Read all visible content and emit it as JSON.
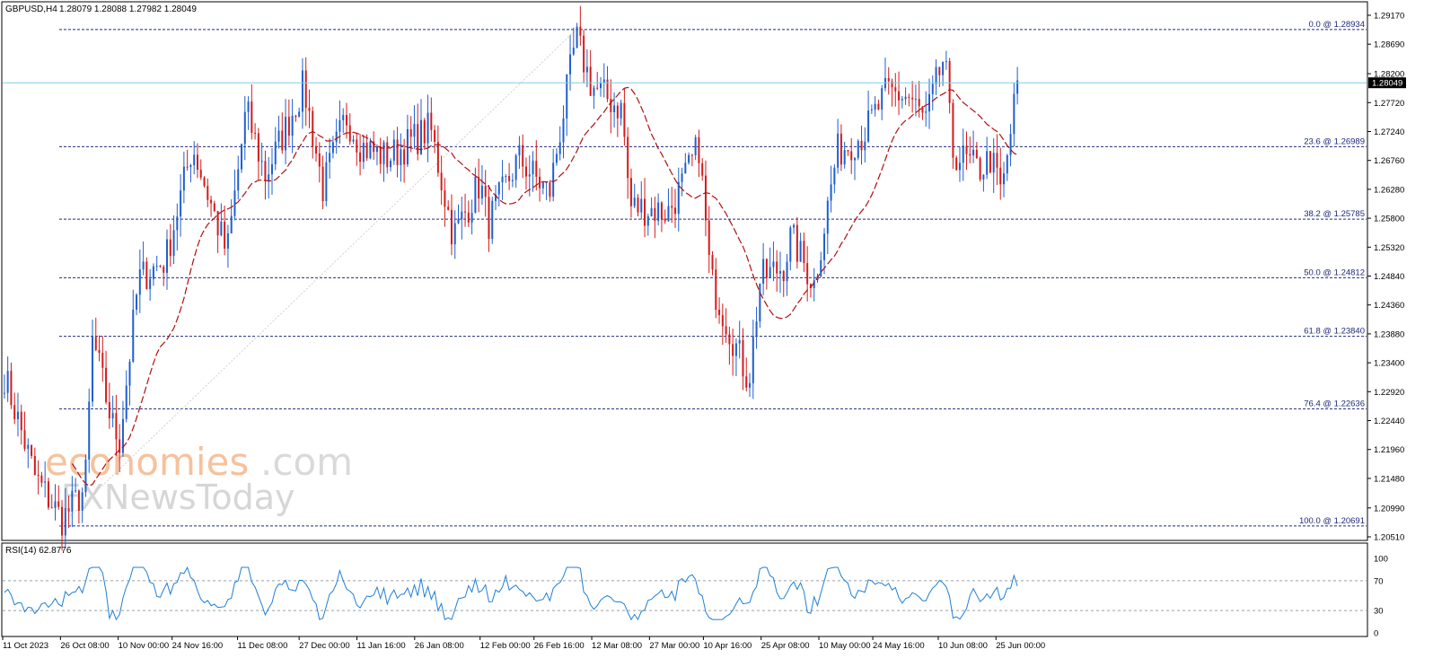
{
  "header": {
    "symbol": "GBPUSD,H4",
    "ohlc": "1.28079 1.28088 1.27982 1.28049"
  },
  "watermark": {
    "brand_a": "economies",
    "brand_b": ".com",
    "brand_c": "FXNewsToday"
  },
  "colors": {
    "candle": "#d41b1b",
    "candle_up": "#1f5fcf",
    "ma": "#b01010",
    "fib": "#1e2a7a",
    "current": "#7fcde6",
    "rsi": "#1e7fd6",
    "rsi_guides": "#9aa0a6"
  },
  "price_axis": {
    "ticks": [
      "1.29170",
      "1.28690",
      "1.28200",
      "1.27720",
      "1.27240",
      "1.26760",
      "1.26280",
      "1.25800",
      "1.25320",
      "1.24840",
      "1.24360",
      "1.23880",
      "1.23400",
      "1.22920",
      "1.22440",
      "1.21960",
      "1.21480",
      "1.20990",
      "1.20510"
    ],
    "current_price": "1.28049"
  },
  "time_axis": {
    "ticks": [
      "11 Oct 2023",
      "26 Oct 08:00",
      "10 Nov 00:00",
      "24 Nov 16:00",
      "11 Dec 08:00",
      "27 Dec 00:00",
      "11 Jan 16:00",
      "26 Jan 08:00",
      "12 Feb 00:00",
      "26 Feb 16:00",
      "12 Mar 08:00",
      "27 Mar 00:00",
      "10 Apr 16:00",
      "25 Apr 08:00",
      "10 May 00:00",
      "24 May 16:00",
      "10 Jun 08:00",
      "25 Jun 00:00"
    ]
  },
  "fib_levels": [
    {
      "label": "0.0 @ 1.28934"
    },
    {
      "label": "23.6 @ 1.26989"
    },
    {
      "label": "38.2 @ 1.25785"
    },
    {
      "label": "50.0 @ 1.24812"
    },
    {
      "label": "61.8 @ 1.23840"
    },
    {
      "label": "76.4 @ 1.22636"
    },
    {
      "label": "100.0 @ 1.20691"
    }
  ],
  "rsi": {
    "label": "RSI(14) 62.8776",
    "ticks": [
      "100",
      "70",
      "30",
      "0"
    ]
  },
  "chart_data": [
    {
      "type": "candlestick",
      "title": "GBPUSD,H4",
      "ylim": [
        1.2051,
        1.2917
      ],
      "x_start": "11 Oct 2023",
      "x_end": "1 Jul 2024",
      "waypoints": [
        {
          "x": "11 Oct 2023",
          "y": 1.232
        },
        {
          "x": "19 Oct 2023",
          "y": 1.215
        },
        {
          "x": "26 Oct 2023",
          "y": 1.208
        },
        {
          "x": "1 Nov 2023",
          "y": 1.213
        },
        {
          "x": "3 Nov 2023",
          "y": 1.238
        },
        {
          "x": "8 Nov 2023",
          "y": 1.224
        },
        {
          "x": "10 Nov 2023",
          "y": 1.221
        },
        {
          "x": "15 Nov 2023",
          "y": 1.248
        },
        {
          "x": "22 Nov 2023",
          "y": 1.251
        },
        {
          "x": "29 Nov 2023",
          "y": 1.27
        },
        {
          "x": "4 Dec 2023",
          "y": 1.26
        },
        {
          "x": "8 Dec 2023",
          "y": 1.252
        },
        {
          "x": "13 Dec 2023",
          "y": 1.276
        },
        {
          "x": "18 Dec 2023",
          "y": 1.265
        },
        {
          "x": "28 Dec 2023",
          "y": 1.28
        },
        {
          "x": "2 Jan 2024",
          "y": 1.263
        },
        {
          "x": "8 Jan 2024",
          "y": 1.275
        },
        {
          "x": "12 Jan 2024",
          "y": 1.27
        },
        {
          "x": "19 Jan 2024",
          "y": 1.268
        },
        {
          "x": "30 Jan 2024",
          "y": 1.273
        },
        {
          "x": "5 Feb 2024",
          "y": 1.255
        },
        {
          "x": "12 Feb 2024",
          "y": 1.264
        },
        {
          "x": "14 Feb 2024",
          "y": 1.257
        },
        {
          "x": "22 Feb 2024",
          "y": 1.268
        },
        {
          "x": "1 Mar 2024",
          "y": 1.262
        },
        {
          "x": "8 Mar 2024",
          "y": 1.288
        },
        {
          "x": "12 Mar 2024",
          "y": 1.28
        },
        {
          "x": "20 Mar 2024",
          "y": 1.276
        },
        {
          "x": "22 Mar 2024",
          "y": 1.26
        },
        {
          "x": "1 Apr 2024",
          "y": 1.259
        },
        {
          "x": "5 Apr 2024",
          "y": 1.264
        },
        {
          "x": "9 Apr 2024",
          "y": 1.27
        },
        {
          "x": "12 Apr 2024",
          "y": 1.248
        },
        {
          "x": "22 Apr 2024",
          "y": 1.231
        },
        {
          "x": "25 Apr 2024",
          "y": 1.248
        },
        {
          "x": "1 May 2024",
          "y": 1.25
        },
        {
          "x": "3 May 2024",
          "y": 1.255
        },
        {
          "x": "9 May 2024",
          "y": 1.247
        },
        {
          "x": "15 May 2024",
          "y": 1.269
        },
        {
          "x": "22 May 2024",
          "y": 1.272
        },
        {
          "x": "28 May 2024",
          "y": 1.279
        },
        {
          "x": "3 Jun 2024",
          "y": 1.278
        },
        {
          "x": "7 Jun 2024",
          "y": 1.274
        },
        {
          "x": "12 Jun 2024",
          "y": 1.285
        },
        {
          "x": "14 Jun 2024",
          "y": 1.269
        },
        {
          "x": "21 Jun 2024",
          "y": 1.266
        },
        {
          "x": "24 Jun 2024",
          "y": 1.268
        },
        {
          "x": "27 Jun 2024",
          "y": 1.262
        },
        {
          "x": "1 Jul 2024",
          "y": 1.2805
        }
      ]
    },
    {
      "type": "line",
      "title": "RSI(14) 62.8776",
      "ylim": [
        0,
        100
      ],
      "guides": [
        70,
        30
      ],
      "x_start": "11 Oct 2023",
      "x_end": "1 Jul 2024",
      "last_value": 62.8776
    }
  ]
}
